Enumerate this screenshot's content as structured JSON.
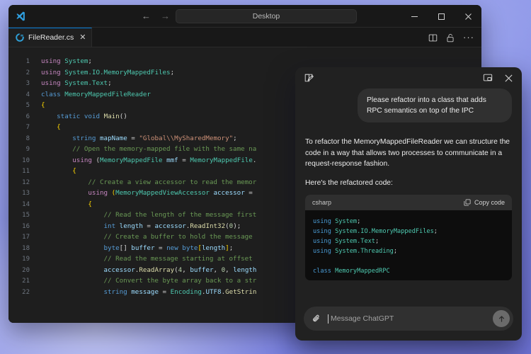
{
  "window": {
    "app_logo": "vscode-logo",
    "command_center_text": "Desktop",
    "nav_back": "←",
    "nav_forward": "→",
    "minimize_label": "minimize",
    "maximize_label": "maximize",
    "close_label": "close"
  },
  "tabbar": {
    "tab": {
      "icon": "csharp-file-icon",
      "label": "FileReader.cs",
      "close": "✕"
    },
    "actions": {
      "split_editor": "split-editor-icon",
      "unlock": "unlock-icon",
      "more": "···"
    }
  },
  "editor": {
    "lines": [
      {
        "n": "1",
        "html": "<span class=\"kw\">using</span> <span class=\"ns\">System</span><span class=\"pn\">;</span>"
      },
      {
        "n": "2",
        "html": "<span class=\"kw\">using</span> <span class=\"ns\">System.IO.MemoryMappedFiles</span><span class=\"pn\">;</span>"
      },
      {
        "n": "3",
        "html": "<span class=\"kw\">using</span> <span class=\"ns\">System.Text</span><span class=\"pn\">;</span>"
      },
      {
        "n": "4",
        "html": "<span class=\"kw2\">class</span> <span class=\"type\">MemoryMappedFileReader</span>"
      },
      {
        "n": "5",
        "html": "<span class=\"br\">{</span>"
      },
      {
        "n": "6",
        "html": "    <span class=\"kw2\">static</span> <span class=\"kw2\">void</span> <span class=\"fn\">Main</span><span class=\"pn\">()</span>"
      },
      {
        "n": "7",
        "html": "    <span class=\"br\">{</span>"
      },
      {
        "n": "8",
        "html": "        <span class=\"kw2\">string</span> <span class=\"var\">mapName</span> <span class=\"pn\">=</span> <span class=\"str\">\"Global\\\\MySharedMemory\"</span><span class=\"pn\">;</span>"
      },
      {
        "n": "9",
        "html": "        <span class=\"cmt\">// Open the memory-mapped file with the same na</span>"
      },
      {
        "n": "10",
        "html": "        <span class=\"kw\">using</span> <span class=\"pn\">(</span><span class=\"type\">MemoryMappedFile</span> <span class=\"var\">mmf</span> <span class=\"pn\">=</span> <span class=\"type\">MemoryMappedFile</span><span class=\"pn\">.</span>"
      },
      {
        "n": "11",
        "html": "        <span class=\"br\">{</span>"
      },
      {
        "n": "12",
        "html": "            <span class=\"cmt\">// Create a view accessor to read the memor</span>"
      },
      {
        "n": "13",
        "html": "            <span class=\"kw\">using</span> <span class=\"br\">(</span><span class=\"type\">MemoryMappedViewAccessor</span> <span class=\"var\">accessor</span> <span class=\"pn\">=</span>"
      },
      {
        "n": "14",
        "html": "            <span class=\"br\">{</span>"
      },
      {
        "n": "15",
        "html": "                <span class=\"cmt\">// Read the length of the message first</span>"
      },
      {
        "n": "16",
        "html": "                <span class=\"kw2\">int</span> <span class=\"var\">length</span> <span class=\"pn\">=</span> <span class=\"var\">accessor</span><span class=\"pn\">.</span><span class=\"fn\">ReadInt32</span><span class=\"pn\">(</span><span class=\"num\">0</span><span class=\"pn\">);</span>"
      },
      {
        "n": "17",
        "html": "                <span class=\"cmt\">// Create a buffer to hold the message</span>"
      },
      {
        "n": "18",
        "html": "                <span class=\"kw2\">byte</span><span class=\"pn\">[]</span> <span class=\"var\">buffer</span> <span class=\"pn\">=</span> <span class=\"kw2\">new</span> <span class=\"kw2\">byte</span><span class=\"br\">[</span><span class=\"var\">length</span><span class=\"br\">]</span><span class=\"pn\">;</span>"
      },
      {
        "n": "19",
        "html": "                <span class=\"cmt\">// Read the message starting at offset</span>"
      },
      {
        "n": "20",
        "html": "                <span class=\"var\">accessor</span><span class=\"pn\">.</span><span class=\"fn\">ReadArray</span><span class=\"pn\">(</span><span class=\"num\">4</span><span class=\"pn\">,</span> <span class=\"var\">buffer</span><span class=\"pn\">,</span> <span class=\"num\">0</span><span class=\"pn\">,</span> <span class=\"var\">length</span>"
      },
      {
        "n": "21",
        "html": "                <span class=\"cmt\">// Convert the byte array back to a str</span>"
      },
      {
        "n": "22",
        "html": "                <span class=\"kw2\">string</span> <span class=\"var\">message</span> <span class=\"pn\">=</span> <span class=\"type\">Encoding</span><span class=\"pn\">.</span><span class=\"var\">UTF8</span><span class=\"pn\">.</span><span class=\"fn\">GetStrin</span>"
      }
    ]
  },
  "chat": {
    "header": {
      "new_chat": "new-chat-icon",
      "pip": "picture-in-picture-icon",
      "close": "✕"
    },
    "user_message": "Please refactor into a class that adds RPC semantics on top of the IPC",
    "assistant_paragraph_1": "To refactor the MemoryMappedFileReader we can structure the code in a way that allows two processes to communicate in a request-response fashion.",
    "assistant_paragraph_2": "Here's the refactored code:",
    "code_block": {
      "language": "csharp",
      "copy_label": "Copy code",
      "lines": [
        {
          "html": "<span class=\"cc-kw\">using</span> <span class=\"cc-ns\">System</span><span class=\"cc-p\">;</span>"
        },
        {
          "html": "<span class=\"cc-kw\">using</span> <span class=\"cc-ns\">System.IO.MemoryMappedFiles</span><span class=\"cc-p\">;</span>"
        },
        {
          "html": "<span class=\"cc-kw\">using</span> <span class=\"cc-ns\">System.Text</span><span class=\"cc-p\">;</span>"
        },
        {
          "html": "<span class=\"cc-kw\">using</span> <span class=\"cc-ns\">System.Threading</span><span class=\"cc-p\">;</span>"
        },
        {
          "html": ""
        },
        {
          "html": "<span class=\"cc-kw\">class</span> <span class=\"cc-cls\">MemoryMappedRPC</span>"
        }
      ]
    },
    "composer": {
      "attach": "paperclip-icon",
      "placeholder": "Message ChatGPT",
      "send": "send-arrow-icon"
    }
  },
  "colors": {
    "accent": "#0078d4",
    "panel_bg": "#212121",
    "editor_bg": "#1e1e1e",
    "desktop": "#8f98e8"
  }
}
